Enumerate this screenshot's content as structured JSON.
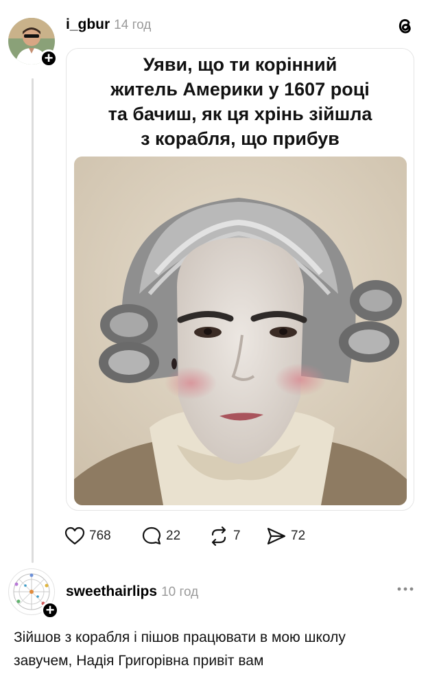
{
  "post": {
    "username": "i_gbur",
    "time": "14 год",
    "meme_lines": [
      "Уяви, що ти корінний",
      "житель Америки у 1607 році",
      "та бачиш, як ця хрінь зійшла",
      "з корабля, що прибув"
    ],
    "stats": {
      "likes": "768",
      "comments": "22",
      "reposts": "7",
      "shares": "72"
    }
  },
  "reply": {
    "username": "sweethairlips",
    "time": "10 год",
    "text_line1": "Зійшов з корабля і пішов працювати в мою школу",
    "text_line2": "завучем, Надія Григорівна привіт вам"
  },
  "icons": {
    "logo": "threads-logo-icon",
    "like": "heart-icon",
    "comment": "comment-bubble-icon",
    "repost": "repost-icon",
    "share": "send-icon",
    "more": "more-dots-icon",
    "follow": "plus-icon"
  }
}
